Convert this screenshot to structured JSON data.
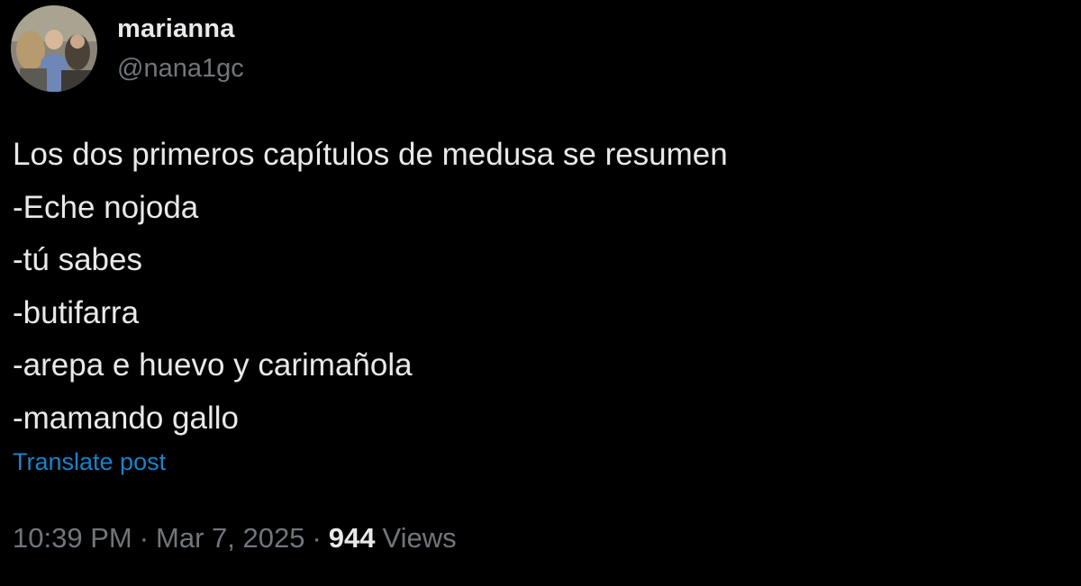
{
  "author": {
    "display_name": "marianna",
    "handle": "@nana1gc"
  },
  "post": {
    "lines": [
      "Los dos primeros capítulos de medusa se resumen",
      "-Eche nojoda",
      "-tú sabes",
      "-butifarra",
      "-arepa e huevo y carimañola",
      "-mamando gallo"
    ],
    "translate_label": "Translate post"
  },
  "meta": {
    "time": "10:39 PM",
    "separator": "·",
    "date": "Mar 7, 2025",
    "views_count": "944",
    "views_label": "Views"
  },
  "colors": {
    "background": "#000000",
    "text_primary": "#e7e9ea",
    "text_secondary": "#71767b",
    "link": "#1d9bf0"
  },
  "icons": {
    "avatar": "profile-photo"
  }
}
